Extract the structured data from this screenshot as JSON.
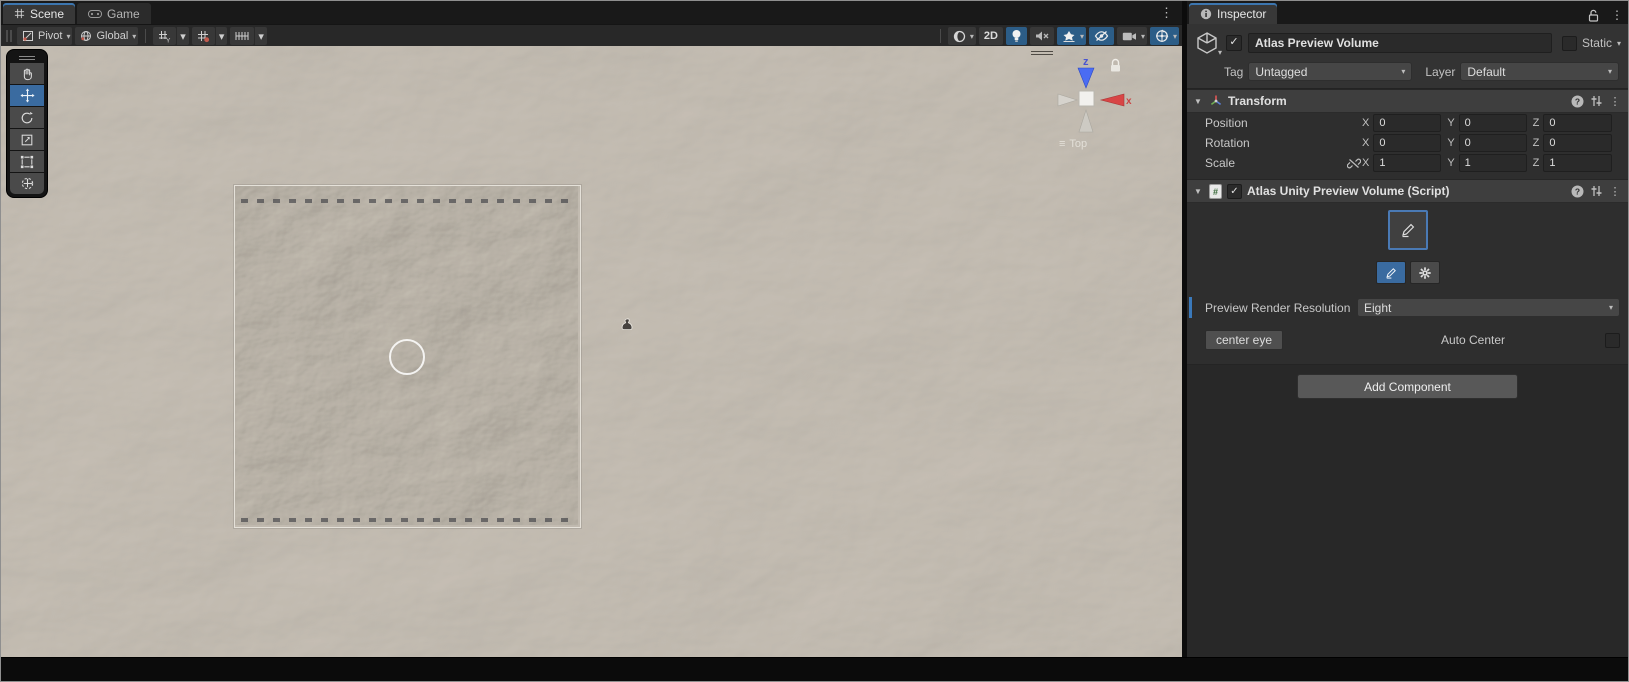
{
  "colors": {
    "accent_blue": "#3c76b0",
    "selection_blue": "#2c5d87",
    "override_blue": "#3a79bb",
    "terrain_beige": "#b3aba1",
    "panel_dark": "#2e2e2e",
    "gizmo_z_blue": "#4a6cf3",
    "gizmo_x_red": "#d84545"
  },
  "icons": {
    "kebab": "⋮",
    "dropdown": "▾",
    "foldout": "▼",
    "check": "✓",
    "help": "?",
    "hamburger": "≡"
  },
  "scene": {
    "tabs": [
      {
        "label": "Scene"
      },
      {
        "label": "Game"
      }
    ],
    "toolbar": {
      "pivot": "Pivot",
      "global": "Global",
      "mode_2d": "2D"
    },
    "gizmo": {
      "z_label": "z",
      "x_label": "x",
      "view_label": "Top"
    }
  },
  "inspector": {
    "tab": "Inspector",
    "gameobject": {
      "name": "Atlas Preview Volume",
      "static_label": "Static",
      "tag_label": "Tag",
      "tag_value": "Untagged",
      "layer_label": "Layer",
      "layer_value": "Default"
    },
    "transform": {
      "title": "Transform",
      "axis": {
        "x": "X",
        "y": "Y",
        "z": "Z"
      },
      "rows": [
        {
          "label": "Position",
          "x": "0",
          "y": "0",
          "z": "0"
        },
        {
          "label": "Rotation",
          "x": "0",
          "y": "0",
          "z": "0"
        },
        {
          "label": "Scale",
          "x": "1",
          "y": "1",
          "z": "1"
        }
      ]
    },
    "script": {
      "title": "Atlas Unity Preview Volume (Script)",
      "resolution_label": "Preview Render Resolution",
      "resolution_value": "Eight",
      "center_eye_label": "center eye",
      "auto_center_label": "Auto Center"
    },
    "add_component_label": "Add Component"
  }
}
